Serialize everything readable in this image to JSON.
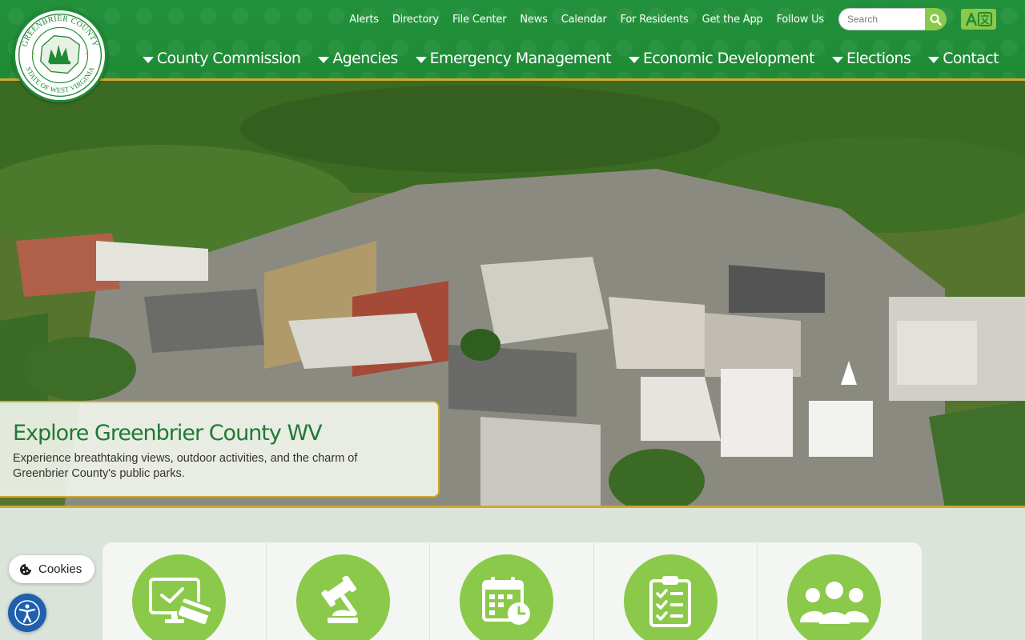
{
  "logo": {
    "name": "greenbrier-county-seal",
    "arc_text_top": "GREENBRIER COUNTY",
    "arc_text_bottom": "STATE OF WEST VIRGINIA"
  },
  "utility_nav": [
    "Alerts",
    "Directory",
    "File Center",
    "News",
    "Calendar",
    "For Residents",
    "Get the App",
    "Follow Us"
  ],
  "search": {
    "placeholder": "Search",
    "value": ""
  },
  "translate": {
    "icon": "translate-icon"
  },
  "main_nav": [
    "County Commission",
    "Agencies",
    "Emergency Management",
    "Economic Development",
    "Elections",
    "Contact"
  ],
  "hero": {
    "title": "Explore Greenbrier County WV",
    "text": "Experience breathtaking views, outdoor activities, and the charm of Greenbrier County's public parks."
  },
  "tiles": [
    {
      "icon": "online-payment-icon"
    },
    {
      "icon": "gavel-icon"
    },
    {
      "icon": "calendar-clock-icon"
    },
    {
      "icon": "checklist-clipboard-icon"
    },
    {
      "icon": "community-group-icon"
    }
  ],
  "cookies": {
    "label": "Cookies"
  },
  "colors": {
    "header_green": "#1f8a36",
    "accent_gold": "#cfa82d",
    "light_green": "#8bc94a",
    "title_green": "#1f7a33",
    "a11y_blue": "#1f5fae"
  }
}
